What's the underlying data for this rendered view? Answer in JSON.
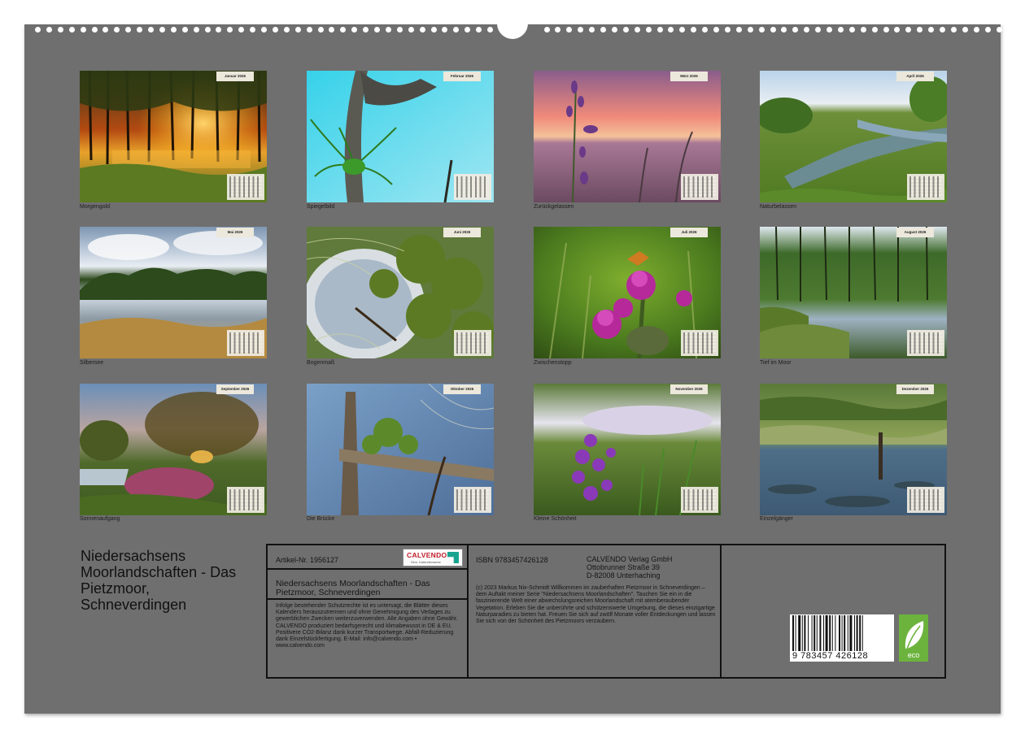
{
  "calendar": {
    "title": "Niedersachsens Moorlandschaften - Das Pietzmoor, Schneverdingen",
    "months": [
      {
        "tag": "Januar 2026",
        "caption": "Morgengold"
      },
      {
        "tag": "Februar 2026",
        "caption": "Spiegelbild"
      },
      {
        "tag": "März 2026",
        "caption": "Zurückgelassen"
      },
      {
        "tag": "April 2026",
        "caption": "Naturbelassen"
      },
      {
        "tag": "Mai 2026",
        "caption": "Silbersee"
      },
      {
        "tag": "Juni 2026",
        "caption": "Bogenmaß"
      },
      {
        "tag": "Juli 2026",
        "caption": "Zwischenstopp"
      },
      {
        "tag": "August 2026",
        "caption": "Tief im Moor"
      },
      {
        "tag": "September 2026",
        "caption": "Sonnenaufgang"
      },
      {
        "tag": "Oktober 2026",
        "caption": "Die Brücke"
      },
      {
        "tag": "November 2026",
        "caption": "Kleine Schönheit"
      },
      {
        "tag": "Dezember 2026",
        "caption": "Einzelgänger"
      }
    ]
  },
  "info": {
    "article": "Artikel-Nr. 1956127",
    "logo_brand": "CALVENDO",
    "logo_sub": "Sinn. Kalenderwerke",
    "subtitle": "Niedersachsens Moorlandschaften - Das Pietzmoor, Schneverdingen",
    "legal": "Infolge bestehender Schutzrechte ist es untersagt, die Blätter dieses Kalenders herauszutrennen und ohne Genehmigung des Verlages zu gewerblichen Zwecken weiterzuverwenden. Alle Angaben ohne Gewähr. CALVENDO produziert bedarfsgerecht und klimabewusst in DE & EU. Positivere CO2-Bilanz dank kurzer Transportwege. Abfall-Reduzierung dank Einzelstückfertigung. E-Mail: info@calvendo.com • www.calvendo.com",
    "isbn": "ISBN 9783457426128",
    "publisher_name": "CALVENDO Verlag GmbH",
    "publisher_street": "Ottobrunner Straße 39",
    "publisher_city": "D-82008 Unterhaching",
    "description": "(c) 2023 Markus Nix-Schmidt Willkommen im zauberhaften Pietzmoor in Schneverdingen – dem Auftakt meiner Serie \"Niedersachsens Moorlandschaften\". Tauchen Sie ein in die faszinierende Welt einer abwechslungsreichen Moorlandschaft mit atemberaubender Vegetation. Erleben Sie die unberührte und schützenswerte Umgebung, die dieses einzigartige Naturparadies zu bieten hat. Freuen Sie sich auf zwölf Monate voller Entdeckungen und lassen Sie sich von der Schönheit des Pietzmoors verzaubern.",
    "barcode_number": "9 783457 426128",
    "eco_label": "eco"
  },
  "colors": {
    "page_background": "#6f6f6f",
    "calvendo_red": "#c21d2a",
    "eco_green": "#6cb33e"
  }
}
